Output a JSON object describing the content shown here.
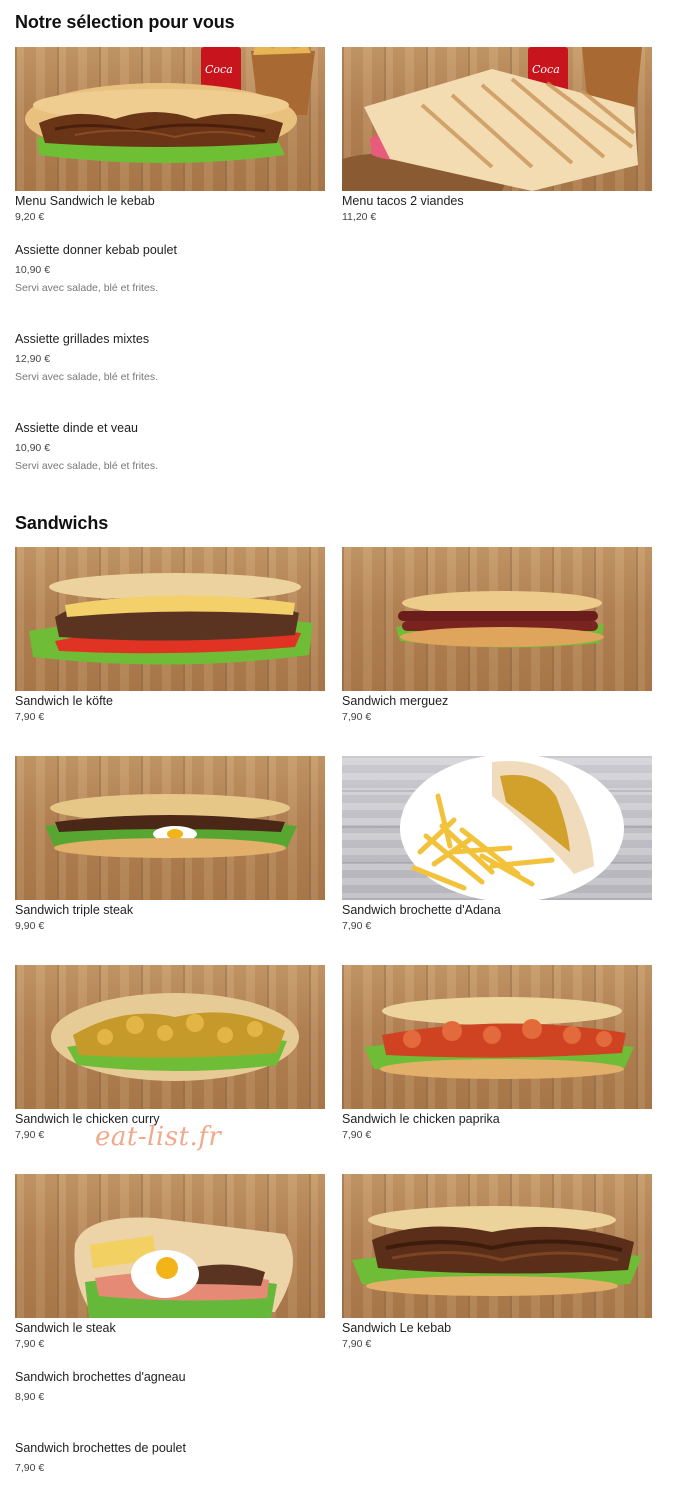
{
  "selection": {
    "title": "Notre sélection pour vous",
    "featured": [
      {
        "name": "Menu Sandwich le kebab",
        "price": "9,20 €"
      },
      {
        "name": "Menu tacos 2 viandes",
        "price": "11,20 €"
      }
    ],
    "plates": [
      {
        "name": "Assiette donner kebab poulet",
        "price": "10,90 €",
        "description": "Servi avec salade, blé et frites."
      },
      {
        "name": "Assiette grillades mixtes",
        "price": "12,90 €",
        "description": "Servi avec salade, blé et frites."
      },
      {
        "name": "Assiette dinde et veau",
        "price": "10,90 €",
        "description": "Servi avec salade, blé et frites."
      }
    ]
  },
  "sandwichs": {
    "title": "Sandwichs",
    "items": [
      {
        "name": "Sandwich le köfte",
        "price": "7,90 €"
      },
      {
        "name": "Sandwich merguez",
        "price": "7,90 €"
      },
      {
        "name": "Sandwich triple steak",
        "price": "9,90 €"
      },
      {
        "name": "Sandwich brochette d'Adana",
        "price": "7,90 €"
      },
      {
        "name": "Sandwich le chicken curry",
        "price": "7,90 €"
      },
      {
        "name": "Sandwich le chicken paprika",
        "price": "7,90 €"
      },
      {
        "name": "Sandwich le steak",
        "price": "7,90 €"
      },
      {
        "name": "Sandwich Le kebab",
        "price": "7,90 €"
      }
    ],
    "extra": [
      {
        "name": "Sandwich brochettes d'agneau",
        "price": "8,90 €"
      },
      {
        "name": "Sandwich brochettes de poulet",
        "price": "7,90 €"
      }
    ]
  },
  "watermark": "eat-list.fr",
  "colors": {
    "watermark": "#f2a98a",
    "text": "#1f1f1f",
    "muted": "#777777"
  }
}
